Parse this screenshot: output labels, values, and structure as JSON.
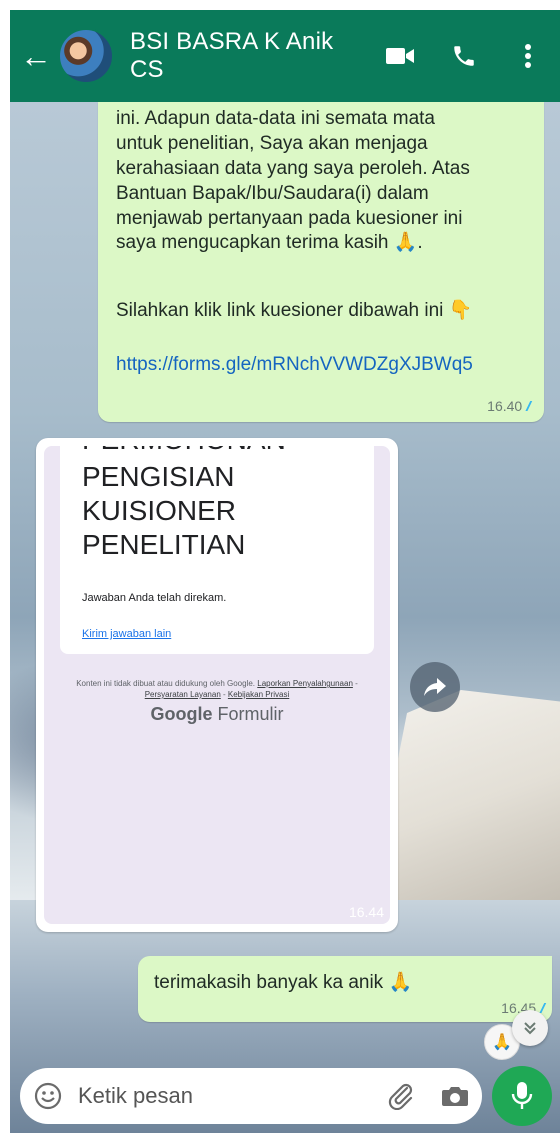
{
  "header": {
    "back_icon": "←",
    "title": "BSI BASRA K Anik CS"
  },
  "messages": [
    {
      "text": "ini. Adapun data-data ini semata mata\nuntuk penelitian, Saya akan menjaga\nkerahasiaan data yang saya peroleh. Atas\nBantuan Bapak/Ibu/Saudara(i) dalam\nmenjawab pertanyaan pada kuesioner ini",
      "line2": "saya mengucapkan terima kasih 🙏.",
      "line3": "Silahkan klik link kuesioner dibawah ini 👇",
      "link": "https://forms.gle/mRNchVVWDZgXJBWq5",
      "time": "16.40",
      "ticks": "//"
    },
    {
      "form_title_cut": "PERMOHONAN",
      "form_title": "PENGISIAN\nKUISIONER\nPENELITIAN",
      "form_subtitle": "Jawaban Anda telah direkam.",
      "form_link": "Kirim jawaban lain",
      "footer_text": "Konten ini tidak dibuat atau didukung oleh Google.",
      "footer_link1": "Laporkan Penyalahgunaan",
      "footer_link2": "Persyaratan Layanan",
      "footer_link3": "Kebijakan Privasi",
      "brand_google": "Google",
      "brand_product": "Formulir",
      "time": "16.44"
    },
    {
      "text": "terimakasih banyak ka anik 🙏",
      "time": "16.45",
      "ticks": "//"
    }
  ],
  "input": {
    "placeholder": "Ketik pesan"
  },
  "colors": {
    "header": "#0a7a5a",
    "outgoing_bubble": "#dcf8c6",
    "mic_button": "#1fa855",
    "link": "#1565c0"
  }
}
